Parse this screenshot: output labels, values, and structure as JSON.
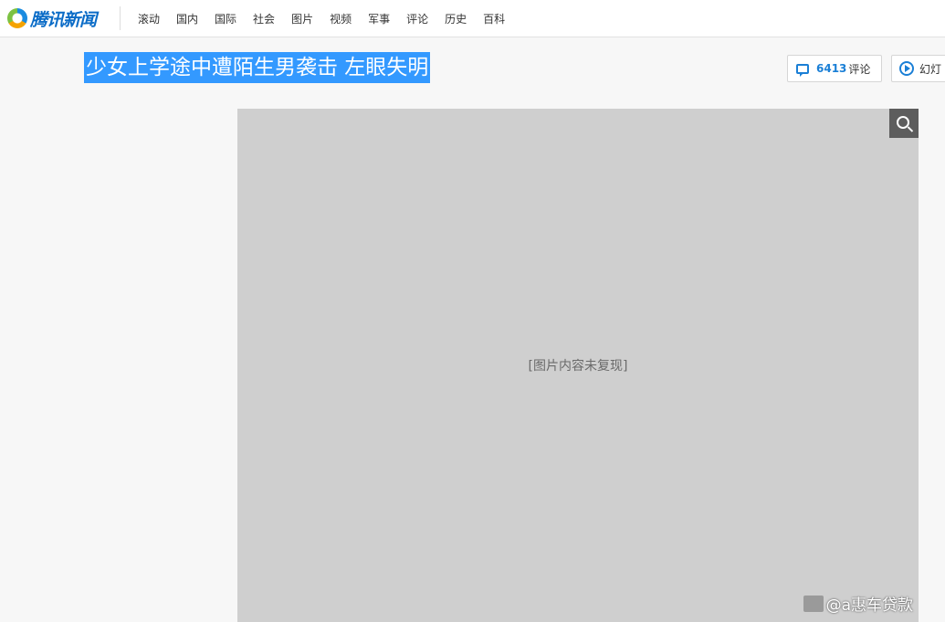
{
  "header": {
    "logo_text": "腾讯新闻",
    "nav": [
      "滚动",
      "国内",
      "国际",
      "社会",
      "图片",
      "视频",
      "军事",
      "评论",
      "历史",
      "百科"
    ]
  },
  "article": {
    "title": "少女上学途中遭陌生男袭击 左眼失明"
  },
  "actions": {
    "comment_count": "6413",
    "comment_label": "评论",
    "slideshow_label": "幻灯"
  },
  "photo": {
    "note": "[图片内容未复现]",
    "watermark": "@a惠车贷款"
  },
  "colors": {
    "title_highlight": "#3399ff",
    "accent": "#1a7fd6"
  }
}
